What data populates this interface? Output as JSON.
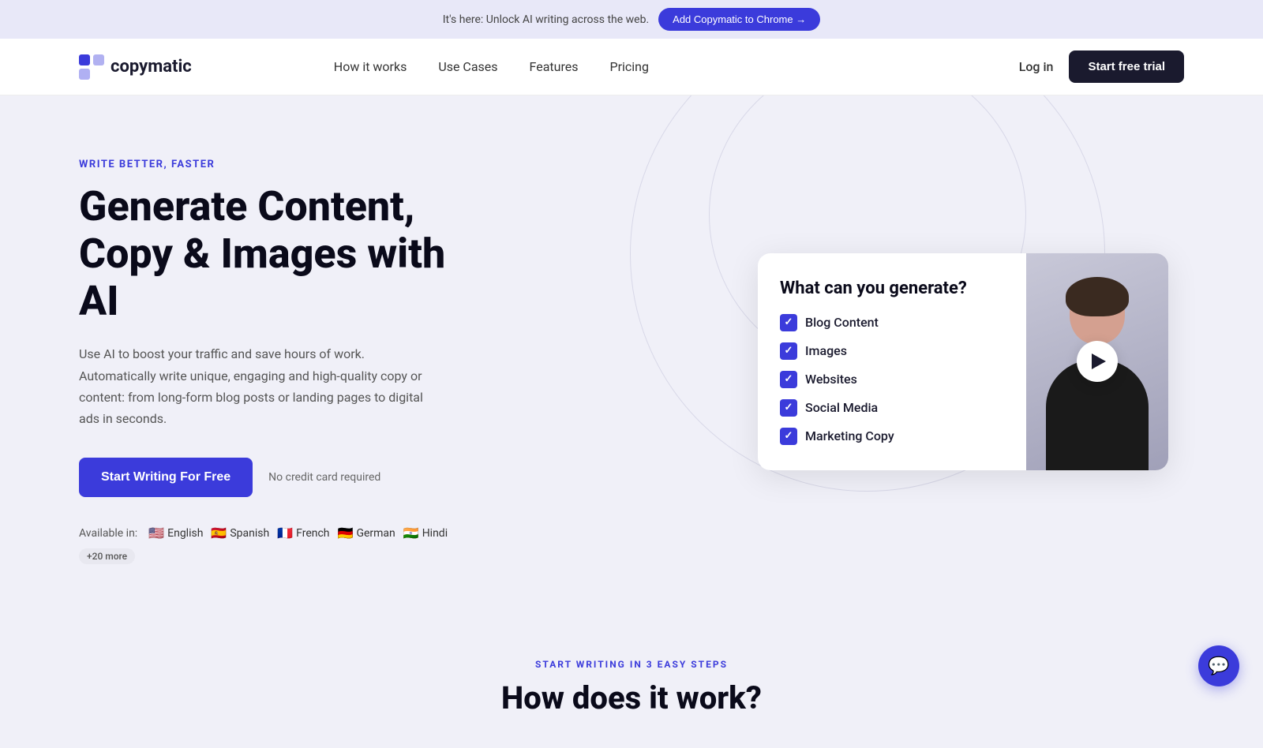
{
  "banner": {
    "text": "It's here: Unlock AI writing across the web.",
    "cta_label": "Add Copymatic to Chrome →"
  },
  "navbar": {
    "logo_text": "copymatic",
    "links": [
      {
        "label": "How it works",
        "href": "#"
      },
      {
        "label": "Use Cases",
        "href": "#"
      },
      {
        "label": "Features",
        "href": "#"
      },
      {
        "label": "Pricing",
        "href": "#"
      }
    ],
    "login_label": "Log in",
    "trial_label": "Start free trial"
  },
  "hero": {
    "eyebrow": "WRITE BETTER, FASTER",
    "title_line1": "Generate Content,",
    "title_line2": "Copy & Images with AI",
    "description": "Use AI to boost your traffic and save hours of work. Automatically write unique, engaging and high-quality copy or content: from long-form blog posts or landing pages to digital ads in seconds.",
    "cta_label": "Start Writing For Free",
    "no_card_text": "No credit card required",
    "available_label": "Available in:",
    "languages": [
      {
        "flag": "🇺🇸",
        "label": "English"
      },
      {
        "flag": "🇪🇸",
        "label": "Spanish"
      },
      {
        "flag": "🇫🇷",
        "label": "French"
      },
      {
        "flag": "🇩🇪",
        "label": "German"
      },
      {
        "flag": "🇮🇳",
        "label": "Hindi"
      }
    ],
    "more_langs": "+20 more"
  },
  "video_card": {
    "title": "What can you generate?",
    "items": [
      "Blog Content",
      "Images",
      "Websites",
      "Social Media",
      "Marketing Copy"
    ]
  },
  "section_steps": {
    "eyebrow": "START WRITING IN 3 EASY STEPS",
    "title": "How does it work?"
  },
  "chat": {
    "icon": "💬"
  }
}
